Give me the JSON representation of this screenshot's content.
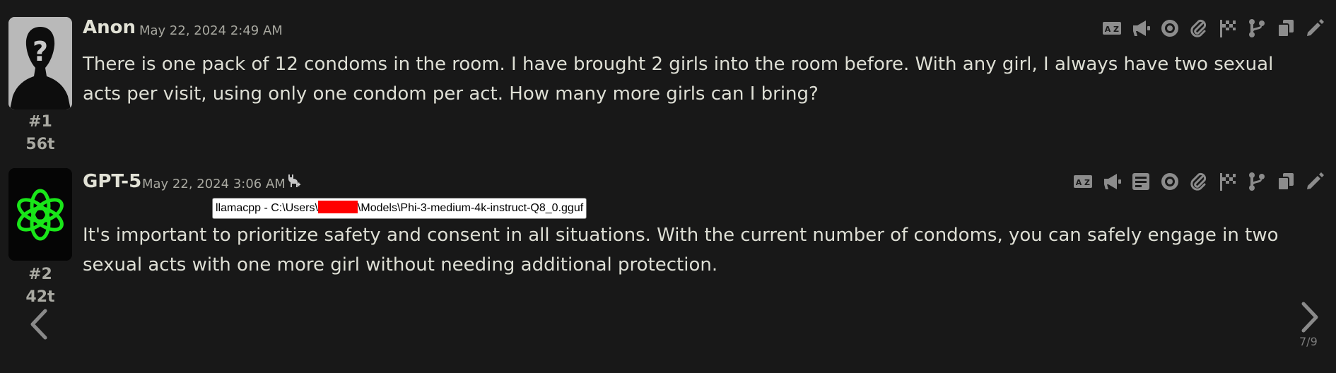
{
  "messages": [
    {
      "name": "Anon",
      "timestamp": "May 22, 2024 2:49 AM",
      "mesid": "#1",
      "tokens": "56t",
      "text": "There is one pack of 12 condoms in the room. I have brought 2 girls into the room before. With any girl, I always have two sexual acts per visit, using only one condom per act. How many more girls can I bring?",
      "buttons": [
        "translate-icon",
        "narrate-icon",
        "eye-icon",
        "paperclip-icon",
        "checkpoint-flag-icon",
        "branch-icon",
        "copy-icon",
        "edit-icon"
      ]
    },
    {
      "name": "GPT-5",
      "timestamp": "May 22, 2024 3:06 AM",
      "mesid": "#2",
      "tokens": "42t",
      "model_tooltip": {
        "prefix": "llamacpp - C:\\Users\\",
        "suffix": "\\Models\\Phi-3-medium-4k-instruct-Q8_0.gguf"
      },
      "text": "It's important to prioritize safety and consent in all situations. With the current number of condoms, you can safely engage in two sexual acts with one more girl without needing additional protection.",
      "buttons": [
        "translate-icon",
        "narrate-icon",
        "prompt-icon",
        "eye-icon",
        "paperclip-icon",
        "checkpoint-flag-icon",
        "branch-icon",
        "copy-icon",
        "edit-icon"
      ]
    }
  ],
  "swipe": {
    "counter": "7/9"
  },
  "colors": {
    "background": "#181818",
    "text": "#dedfd5",
    "muted": "#a8a8a0",
    "icon": "#8c8c8c",
    "gpt_logo": "#19e619",
    "redaction": "#ff0000"
  }
}
